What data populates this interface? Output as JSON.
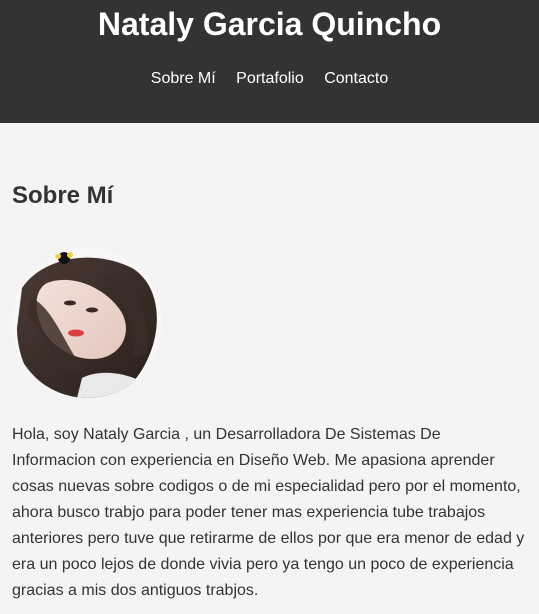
{
  "header": {
    "title": "Nataly Garcia Quincho",
    "nav": [
      {
        "label": "Sobre Mí"
      },
      {
        "label": "Portafolio"
      },
      {
        "label": "Contacto"
      }
    ]
  },
  "about": {
    "heading": "Sobre Mí",
    "avatar_icon": "profile-photo",
    "text": "Hola, soy Nataly Garcia , un Desarrolladora De Sistemas De Informacion con experiencia en Diseño Web. Me apasiona aprender cosas nuevas sobre codigos o de mi especialidad pero por el momento, ahora busco trabjo para poder tener mas experiencia tube trabajos anteriores pero tuve que retirarme de ellos por que era menor de edad y era un poco lejos de donde vivia pero ya tengo un poco de experiencia gracias a mis dos antiguos trabjos."
  },
  "colors": {
    "header_bg": "#333333",
    "page_bg": "#f4f4f4",
    "text": "#333333"
  }
}
